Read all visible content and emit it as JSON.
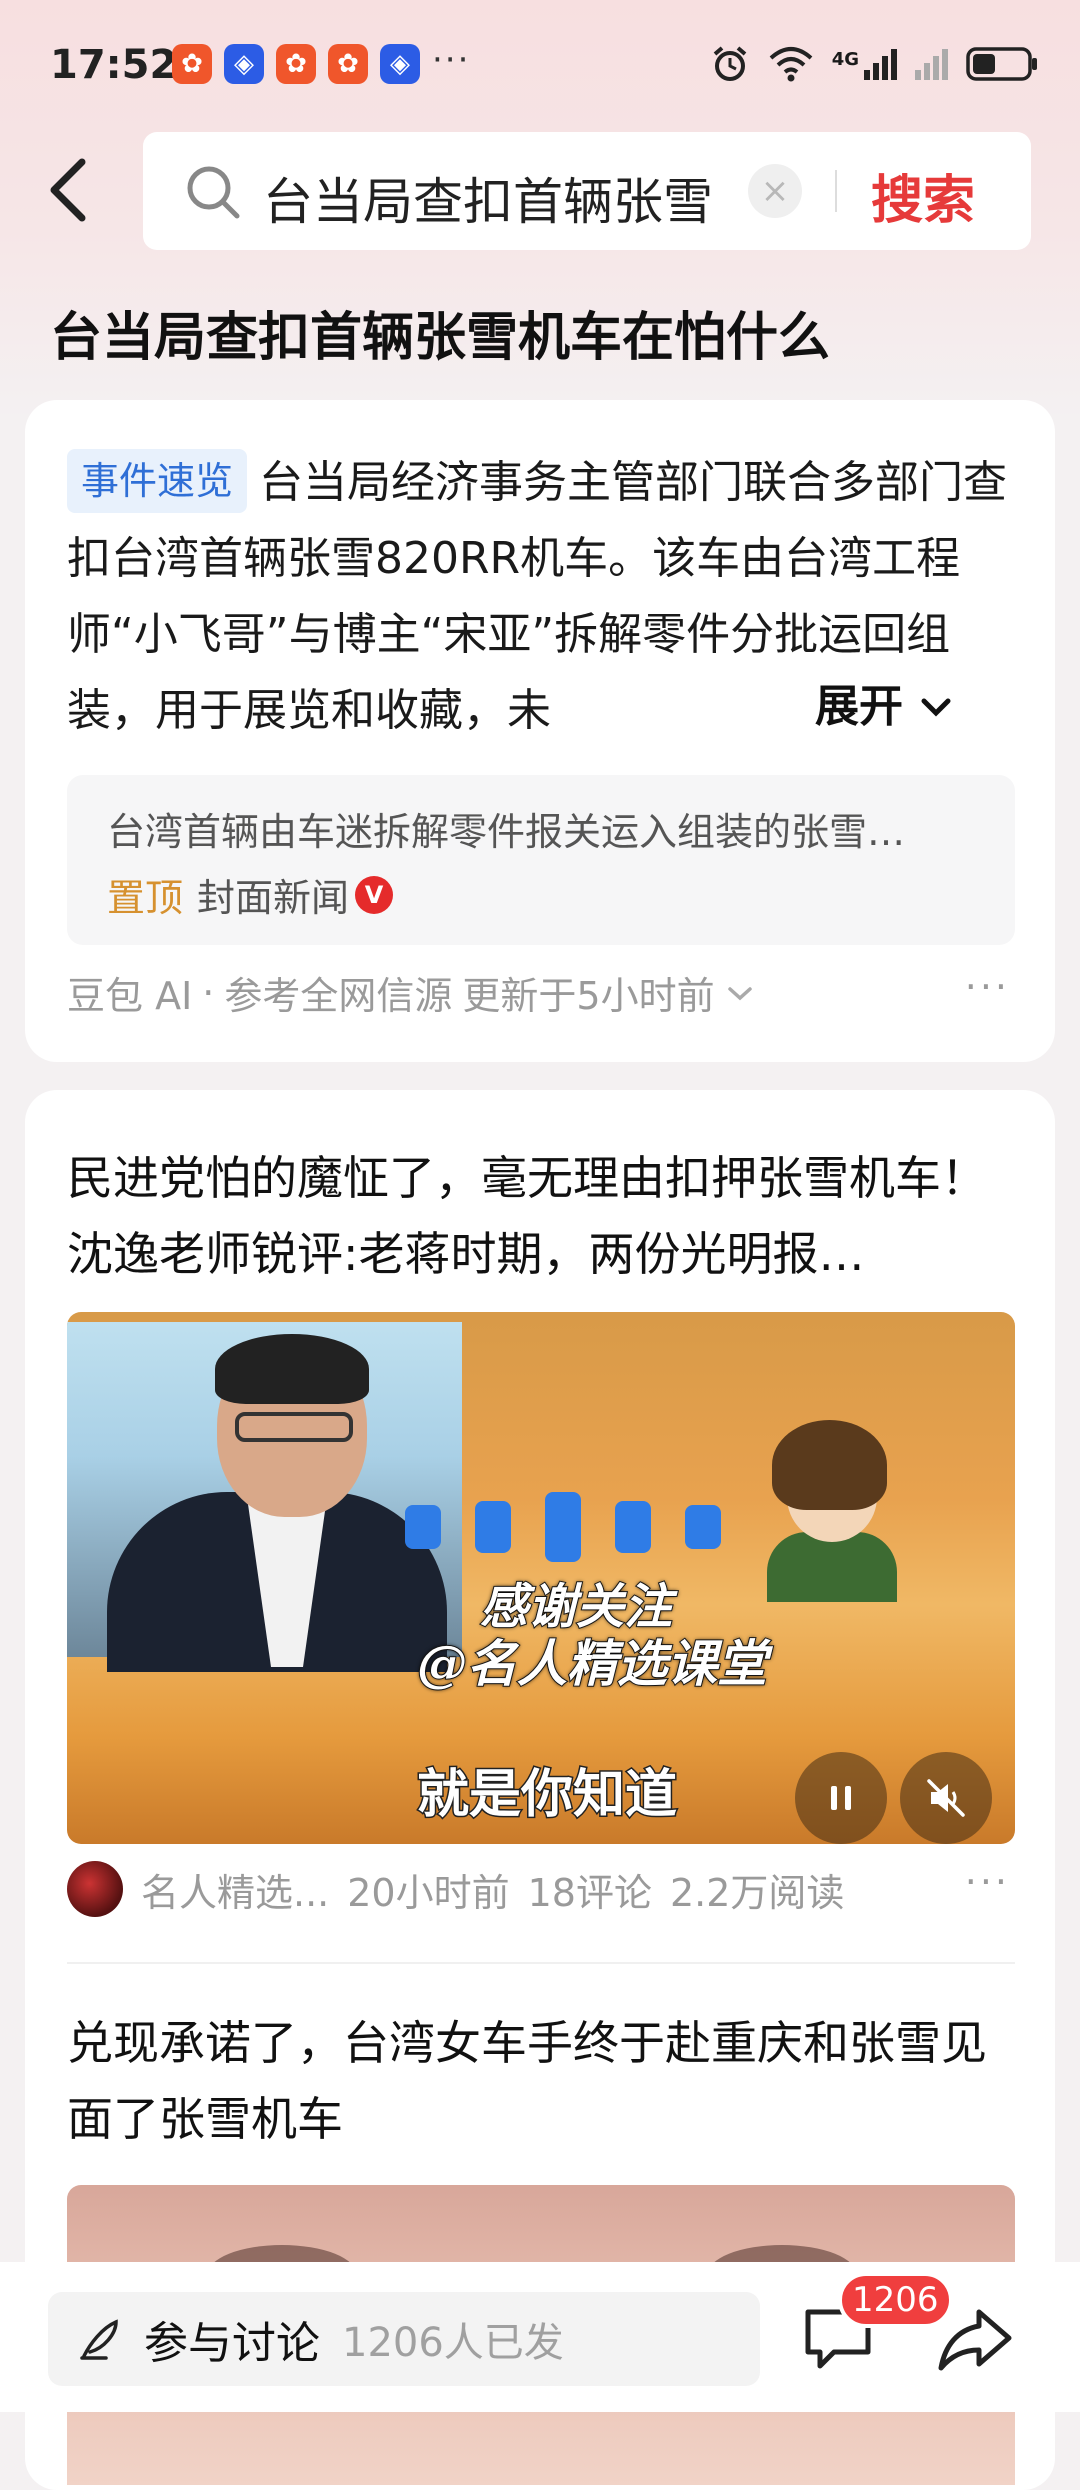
{
  "status_bar": {
    "time": "17:52",
    "app_icons": [
      "app-orange",
      "app-blue",
      "app-orange",
      "app-orange",
      "app-blue"
    ],
    "more": "···",
    "network": "4G"
  },
  "search": {
    "query": "台当局查扣首辆张雪",
    "clear": "×",
    "button": "搜索"
  },
  "page_title": "台当局查扣首辆张雪机车在怕什么",
  "ai_summary": {
    "tag": "事件速览",
    "text": "台当局经济事务主管部门联合多部门查扣台湾首辆张雪820RR机车。该车由台湾工程师“小飞哥”与博主“宋亚”拆解零件分批运回组装，用于展览和收藏，未",
    "expand": "展开",
    "reference": {
      "text": "台湾首辆由车迷拆解零件报关运入组装的张雪…",
      "pin": "置顶",
      "source": "封面新闻",
      "badge": "V"
    },
    "footer": {
      "source": "豆包 AI",
      "dot": "·",
      "ref": "参考全网信源",
      "updated": "更新于5小时前"
    },
    "more": "···"
  },
  "article1": {
    "headline": "民进党怕的魔怔了，毫无理由扣押张雪机车！沈逸老师锐评:老蒋时期，两份光明报…",
    "video": {
      "overlay_line1": "感谢关注",
      "overlay_line2": "@名人精选课堂",
      "subtitle": "就是你知道"
    },
    "author": "名人精选...",
    "time": "20小时前",
    "comments": "18评论",
    "reads": "2.2万阅读",
    "more": "···"
  },
  "article2": {
    "headline": "兑现承诺了，台湾女车手终于赴重庆和张雪见面了张雪机车"
  },
  "bottom_bar": {
    "discuss_label": "参与讨论",
    "discuss_count": "1206人已发",
    "comment_badge": "1206"
  }
}
